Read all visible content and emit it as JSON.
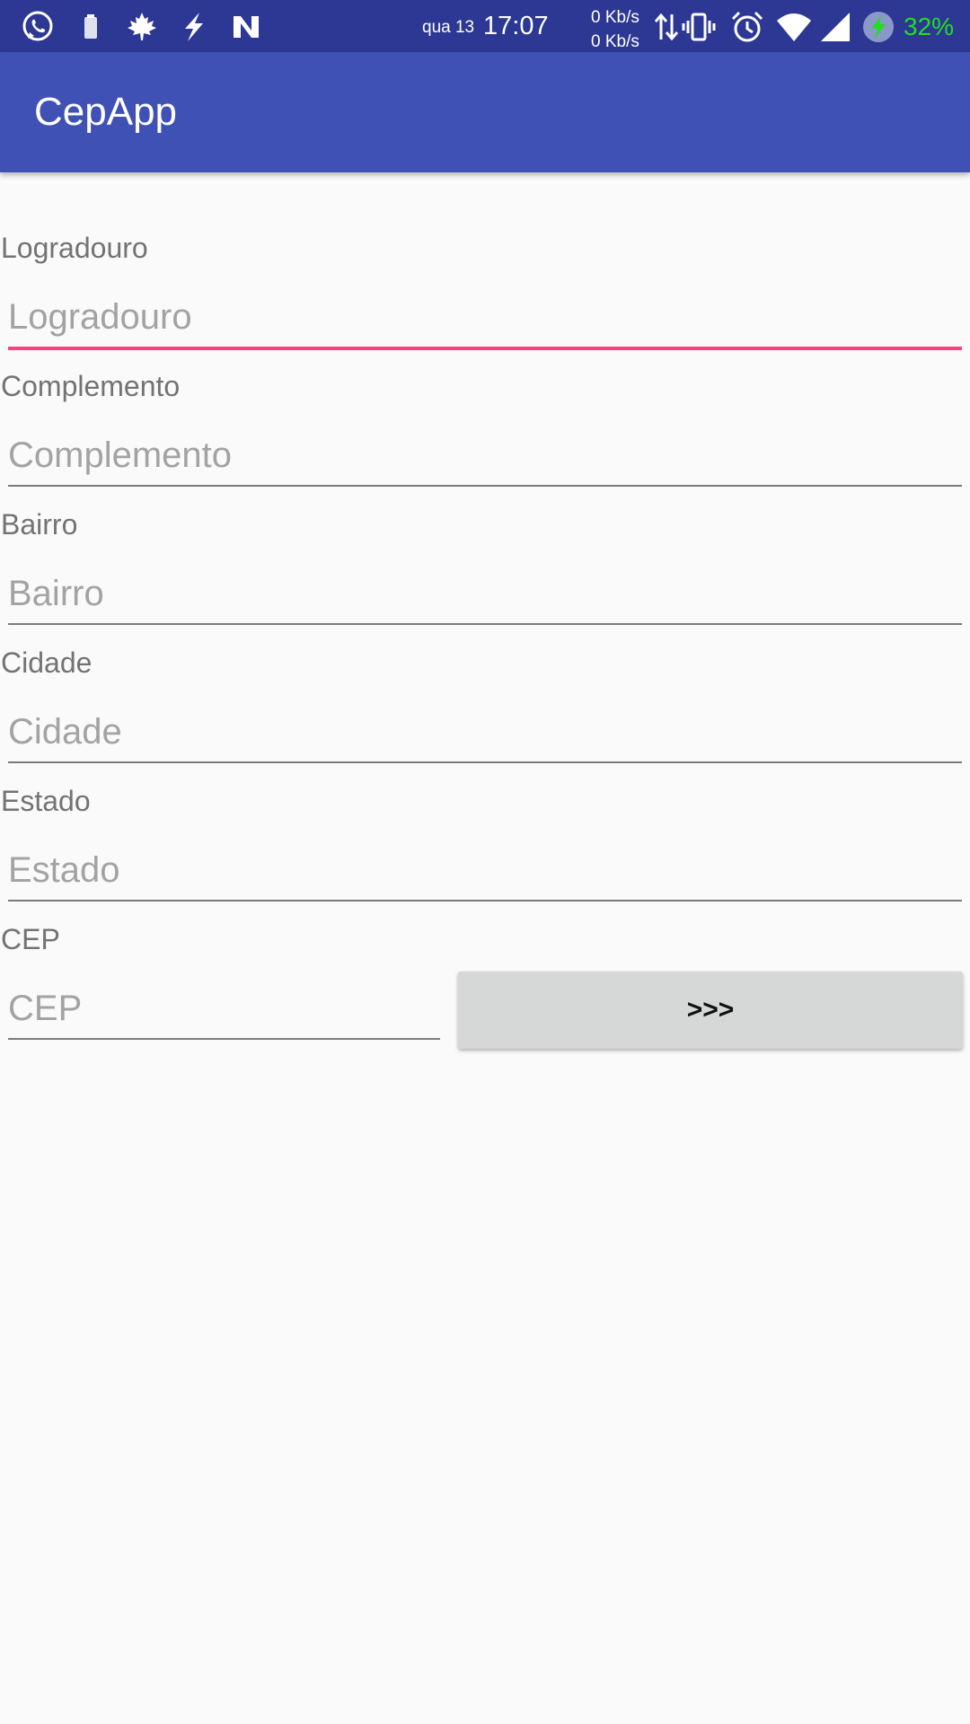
{
  "status_bar": {
    "date": "qua 13",
    "time": "17:07",
    "net_up": "0 Kb/s",
    "net_down": "0 Kb/s",
    "battery": "32%",
    "battery_color": "#22dd22",
    "background": "#2c3893",
    "notification_icons": [
      "whatsapp-icon",
      "battery-saver-icon",
      "maple-leaf-icon",
      "flash-icon",
      "n-logo-icon"
    ],
    "system_icons": [
      "data-transfer-icon",
      "vibrate-icon",
      "alarm-icon",
      "wifi-icon",
      "cell-signal-icon",
      "charging-icon"
    ]
  },
  "app_bar": {
    "title": "CepApp",
    "background": "#3f51b5"
  },
  "form": {
    "accent_color": "#ff4081",
    "fields": [
      {
        "label": "Logradouro",
        "placeholder": "Logradouro",
        "value": "",
        "focused": true
      },
      {
        "label": "Complemento",
        "placeholder": "Complemento",
        "value": ""
      },
      {
        "label": "Bairro",
        "placeholder": "Bairro",
        "value": ""
      },
      {
        "label": "Cidade",
        "placeholder": "Cidade",
        "value": ""
      },
      {
        "label": "Estado",
        "placeholder": "Estado",
        "value": ""
      },
      {
        "label": "CEP",
        "placeholder": "CEP",
        "value": ""
      }
    ],
    "search_button_label": ">>>"
  }
}
